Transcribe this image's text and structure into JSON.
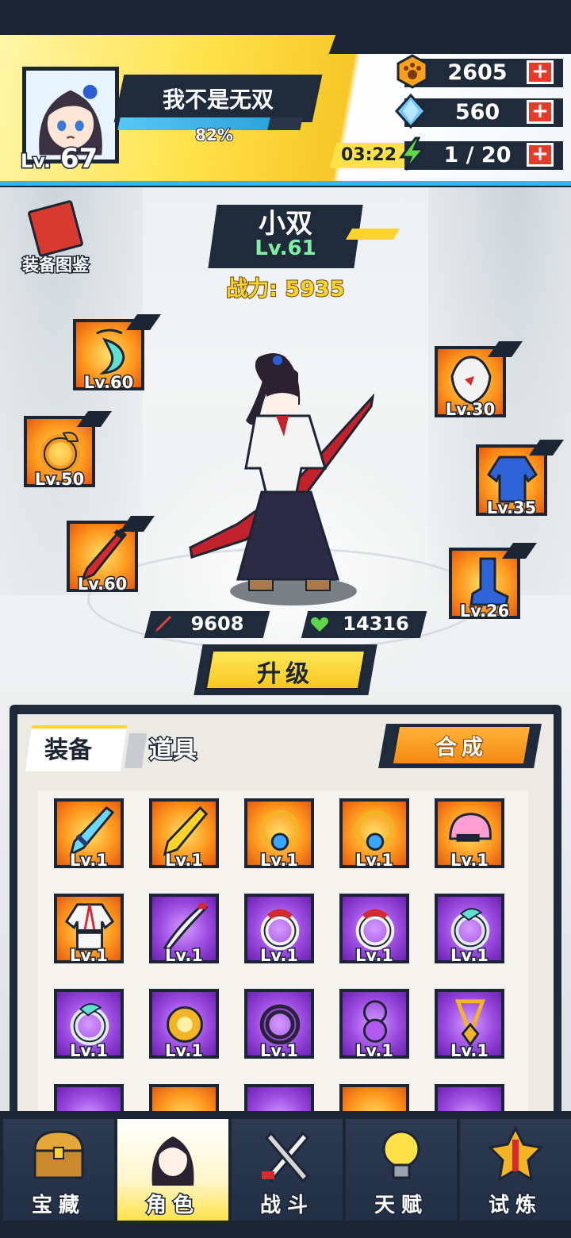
{
  "player": {
    "name": "我不是无双",
    "level_prefix": "Lv.",
    "level": "67",
    "exp_text": "82%",
    "exp_fraction": 0.82
  },
  "resources": {
    "paw": {
      "value": "2605",
      "icon": "paw-coin-icon"
    },
    "gem": {
      "value": "560",
      "icon": "diamond-icon"
    },
    "energy": {
      "value": "1 / 20",
      "timer": "03:22",
      "icon": "lightning-icon"
    },
    "plus": "+"
  },
  "codex": {
    "label": "装备图鉴"
  },
  "hero": {
    "name": "小双",
    "level": "Lv.61",
    "power_label": "战力:",
    "power_value": "5935",
    "attack": "9608",
    "hp": "14316"
  },
  "equipped": {
    "necklace": "Lv.60",
    "ring": "Lv.50",
    "weapon": "Lv.60",
    "helmet": "Lv.30",
    "armor": "Lv.35",
    "boots": "Lv.26"
  },
  "upgrade_label": "升级",
  "panel": {
    "tab_equipment": "装备",
    "tab_items": "道具",
    "compose_label": "合成"
  },
  "inventory": [
    {
      "rarity": "orange",
      "icon": "blue-sword-icon",
      "level": "Lv.1"
    },
    {
      "rarity": "orange",
      "icon": "yellow-blade-icon",
      "level": "Lv.1"
    },
    {
      "rarity": "orange",
      "icon": "gold-necklace-icon",
      "level": "Lv.1"
    },
    {
      "rarity": "orange",
      "icon": "gold-necklace-icon",
      "level": "Lv.1"
    },
    {
      "rarity": "orange",
      "icon": "pink-helmet-icon",
      "level": "Lv.1"
    },
    {
      "rarity": "orange",
      "icon": "karate-gi-icon",
      "level": "Lv.1"
    },
    {
      "rarity": "purple",
      "icon": "white-blade-icon",
      "level": "Lv.1"
    },
    {
      "rarity": "purple",
      "icon": "red-ring-icon",
      "level": "Lv.1"
    },
    {
      "rarity": "purple",
      "icon": "red-ring-icon",
      "level": "Lv.1"
    },
    {
      "rarity": "purple",
      "icon": "teal-ring-icon",
      "level": "Lv.1"
    },
    {
      "rarity": "purple",
      "icon": "teal-ring-icon",
      "level": "Lv.1"
    },
    {
      "rarity": "purple",
      "icon": "gold-ring-icon",
      "level": "Lv.1"
    },
    {
      "rarity": "purple",
      "icon": "dark-ring-icon",
      "level": "Lv.1"
    },
    {
      "rarity": "purple",
      "icon": "purple-pendant-icon",
      "level": "Lv.1"
    },
    {
      "rarity": "purple",
      "icon": "gold-pendant-icon",
      "level": "Lv.1"
    }
  ],
  "nav": [
    {
      "label": "宝藏",
      "icon": "treasure-chest-icon"
    },
    {
      "label": "角色",
      "icon": "character-icon",
      "active": true
    },
    {
      "label": "战斗",
      "icon": "crossed-swords-icon"
    },
    {
      "label": "天赋",
      "icon": "light-bulb-icon"
    },
    {
      "label": "试炼",
      "icon": "trial-emblem-icon"
    }
  ],
  "colors": {
    "navy": "#1c2534",
    "yellow": "#ffe24a",
    "orange_rarity": "#ff9a1f",
    "purple_rarity": "#9b4ae0",
    "red_plus": "#e53b2a",
    "cyan": "#38b6e8"
  }
}
